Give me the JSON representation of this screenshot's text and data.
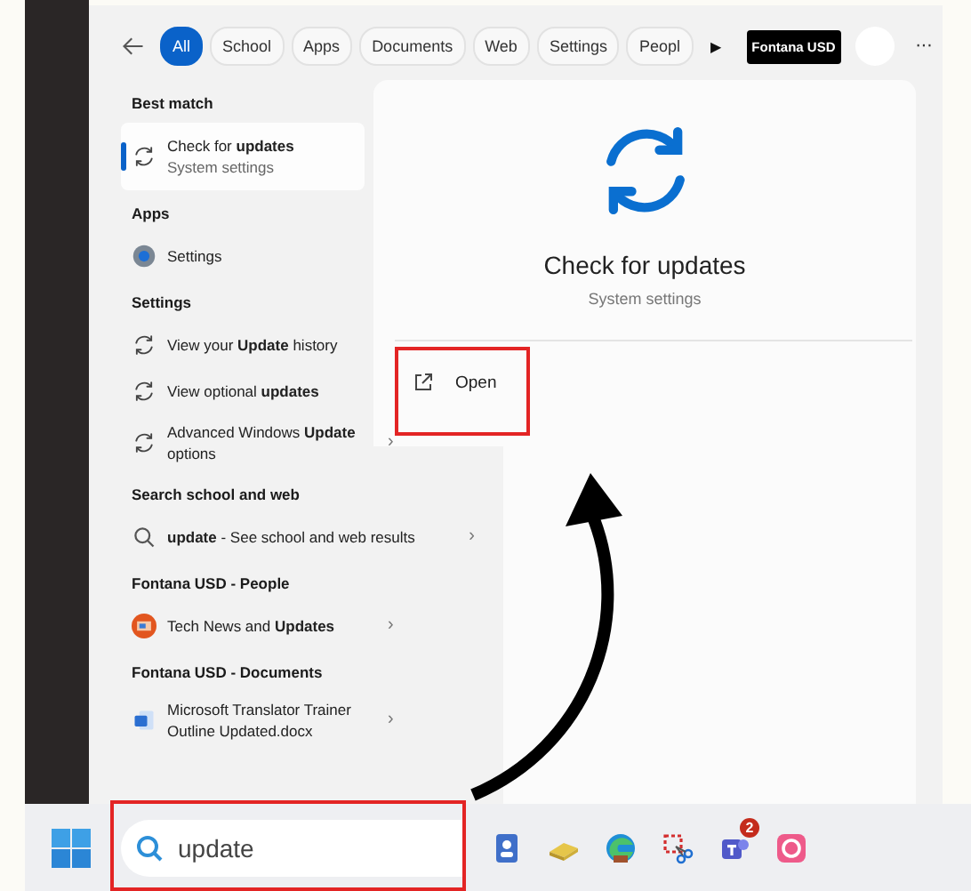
{
  "filters": [
    {
      "label": "All",
      "selected": true
    },
    {
      "label": "School",
      "selected": false
    },
    {
      "label": "Apps",
      "selected": false
    },
    {
      "label": "Documents",
      "selected": false
    },
    {
      "label": "Web",
      "selected": false
    },
    {
      "label": "Settings",
      "selected": false
    },
    {
      "label": "Peopl",
      "selected": false
    }
  ],
  "more_filters": "▶",
  "org_button": "Fontana USD",
  "more_menu": "···",
  "sections": [
    {
      "heading": "Best match",
      "items": [
        {
          "kind": "sync",
          "title": "Check for **updates**",
          "subtitle": "System settings",
          "selected": true
        }
      ]
    },
    {
      "heading": "Apps",
      "items": [
        {
          "kind": "gear",
          "title": "Settings",
          "selected": false
        }
      ]
    },
    {
      "heading": "Settings",
      "items": [
        {
          "kind": "sync",
          "title": "View your **Update** history",
          "selected": false
        },
        {
          "kind": "sync",
          "title": "View optional **updates**",
          "selected": false
        },
        {
          "kind": "sync",
          "title": "Advanced Windows **Update** options",
          "selected": false,
          "chevron": "›"
        }
      ]
    },
    {
      "heading": "Search school and web",
      "items": [
        {
          "kind": "search",
          "title": "**update** - See school and web results",
          "selected": false,
          "chevron": "›"
        }
      ]
    },
    {
      "heading": "Fontana USD - People",
      "items": [
        {
          "kind": "people",
          "title": "Tech News and **Updates**",
          "selected": false,
          "chevron": "›"
        }
      ]
    },
    {
      "heading": "Fontana USD - Documents",
      "items": [
        {
          "kind": "word",
          "title": "Microsoft Translator Trainer Outline Updated.docx",
          "selected": false,
          "chevron": "›"
        }
      ]
    }
  ],
  "detail": {
    "title": "Check for updates",
    "subtitle": "System settings",
    "actions": [
      {
        "label": "Open"
      }
    ]
  },
  "taskbar": {
    "search_value": "update",
    "apps": [
      {
        "kind": "contacts"
      },
      {
        "kind": "notes"
      },
      {
        "kind": "browser"
      },
      {
        "kind": "snip"
      },
      {
        "kind": "teams",
        "badge": "2"
      },
      {
        "kind": "creative"
      }
    ]
  }
}
